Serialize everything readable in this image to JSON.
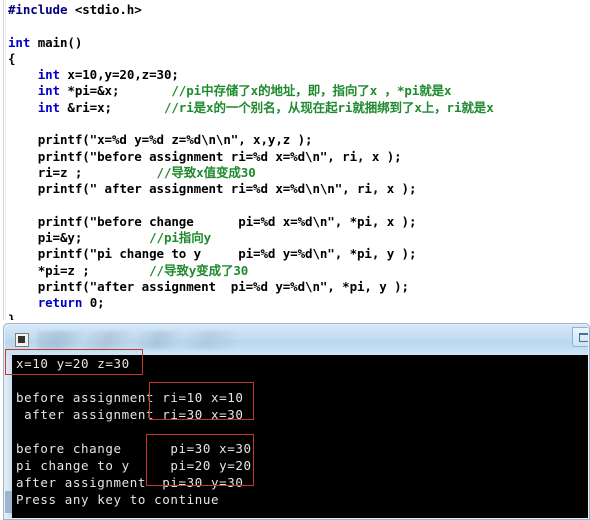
{
  "editor": {
    "name": "source-code-editor",
    "lines": [
      {
        "id": "l1",
        "segments": [
          {
            "t": "#include",
            "c": "pre"
          },
          {
            "t": " <stdio.h>",
            "c": "plain"
          }
        ]
      },
      {
        "id": "l2",
        "segments": [
          {
            "t": "",
            "c": "plain"
          }
        ]
      },
      {
        "id": "l3",
        "segments": [
          {
            "t": "int",
            "c": "kw"
          },
          {
            "t": " main()",
            "c": "plain"
          }
        ]
      },
      {
        "id": "l4",
        "segments": [
          {
            "t": "{",
            "c": "plain"
          }
        ]
      },
      {
        "id": "l5",
        "segments": [
          {
            "t": "    ",
            "c": "plain"
          },
          {
            "t": "int",
            "c": "kw"
          },
          {
            "t": " x=10,y=20,z=30;",
            "c": "plain"
          }
        ]
      },
      {
        "id": "l6",
        "segments": [
          {
            "t": "    ",
            "c": "plain"
          },
          {
            "t": "int",
            "c": "kw"
          },
          {
            "t": " *pi=&x;       ",
            "c": "plain"
          },
          {
            "t": "//pi中存储了x的地址，即，指向了x ，*pi就是x",
            "c": "cmt"
          }
        ]
      },
      {
        "id": "l7",
        "segments": [
          {
            "t": "    ",
            "c": "plain"
          },
          {
            "t": "int",
            "c": "kw"
          },
          {
            "t": " &ri=x;       ",
            "c": "plain"
          },
          {
            "t": "//ri是x的一个别名，从现在起ri就捆绑到了x上，ri就是x",
            "c": "cmt"
          }
        ]
      },
      {
        "id": "l8",
        "segments": [
          {
            "t": "",
            "c": "plain"
          }
        ]
      },
      {
        "id": "l9",
        "segments": [
          {
            "t": "    printf(\"x=%d y=%d z=%d\\n\\n\", x,y,z );",
            "c": "plain"
          }
        ]
      },
      {
        "id": "l10",
        "segments": [
          {
            "t": "    printf(\"before assignment ri=%d x=%d\\n\", ri, x );",
            "c": "plain"
          }
        ]
      },
      {
        "id": "l11",
        "segments": [
          {
            "t": "    ri=z ;          ",
            "c": "plain"
          },
          {
            "t": "//导致x值变成30",
            "c": "cmt"
          }
        ]
      },
      {
        "id": "l12",
        "segments": [
          {
            "t": "    printf(\" after assignment ri=%d x=%d\\n\\n\", ri, x );",
            "c": "plain"
          }
        ]
      },
      {
        "id": "l13",
        "segments": [
          {
            "t": "",
            "c": "plain"
          }
        ]
      },
      {
        "id": "l14",
        "segments": [
          {
            "t": "    printf(\"before change      pi=%d x=%d\\n\", *pi, x );",
            "c": "plain"
          }
        ]
      },
      {
        "id": "l15",
        "segments": [
          {
            "t": "    pi=&y;         ",
            "c": "plain"
          },
          {
            "t": "//pi指向y",
            "c": "cmt"
          }
        ]
      },
      {
        "id": "l16",
        "segments": [
          {
            "t": "    printf(\"pi change to y     pi=%d y=%d\\n\", *pi, y );",
            "c": "plain"
          }
        ]
      },
      {
        "id": "l17",
        "segments": [
          {
            "t": "    *pi=z ;        ",
            "c": "plain"
          },
          {
            "t": "//导致y变成了30",
            "c": "cmt"
          }
        ]
      },
      {
        "id": "l18",
        "segments": [
          {
            "t": "    printf(\"after assignment  pi=%d y=%d\\n\", *pi, y );",
            "c": "plain"
          }
        ]
      },
      {
        "id": "l19",
        "segments": [
          {
            "t": "    ",
            "c": "plain"
          },
          {
            "t": "return",
            "c": "kw"
          },
          {
            "t": " 0;",
            "c": "plain"
          }
        ]
      },
      {
        "id": "l20",
        "segments": [
          {
            "t": "}",
            "c": "plain"
          }
        ]
      }
    ]
  },
  "console": {
    "name": "program-output-console",
    "title": "",
    "icon": "console-app-icon",
    "minimize_label": "minimize",
    "lines": [
      {
        "text": "x=10 y=20 z=30"
      },
      {
        "text": ""
      },
      {
        "text": "before assignment ri=10 x=10"
      },
      {
        "text": " after assignment ri=30 x=30"
      },
      {
        "text": ""
      },
      {
        "text": "before change      pi=30 x=30"
      },
      {
        "text": "pi change to y     pi=20 y=20"
      },
      {
        "text": "after assignment  pi=30 y=30"
      },
      {
        "text": "Press any key to continue"
      }
    ]
  },
  "annotations": {
    "color": "#c0392b",
    "boxes": [
      {
        "id": "annot-box-1",
        "label": "initial-values-highlight"
      },
      {
        "id": "annot-box-2",
        "label": "reference-assignment-highlight"
      },
      {
        "id": "annot-box-3",
        "label": "pointer-assignment-highlight"
      }
    ]
  }
}
